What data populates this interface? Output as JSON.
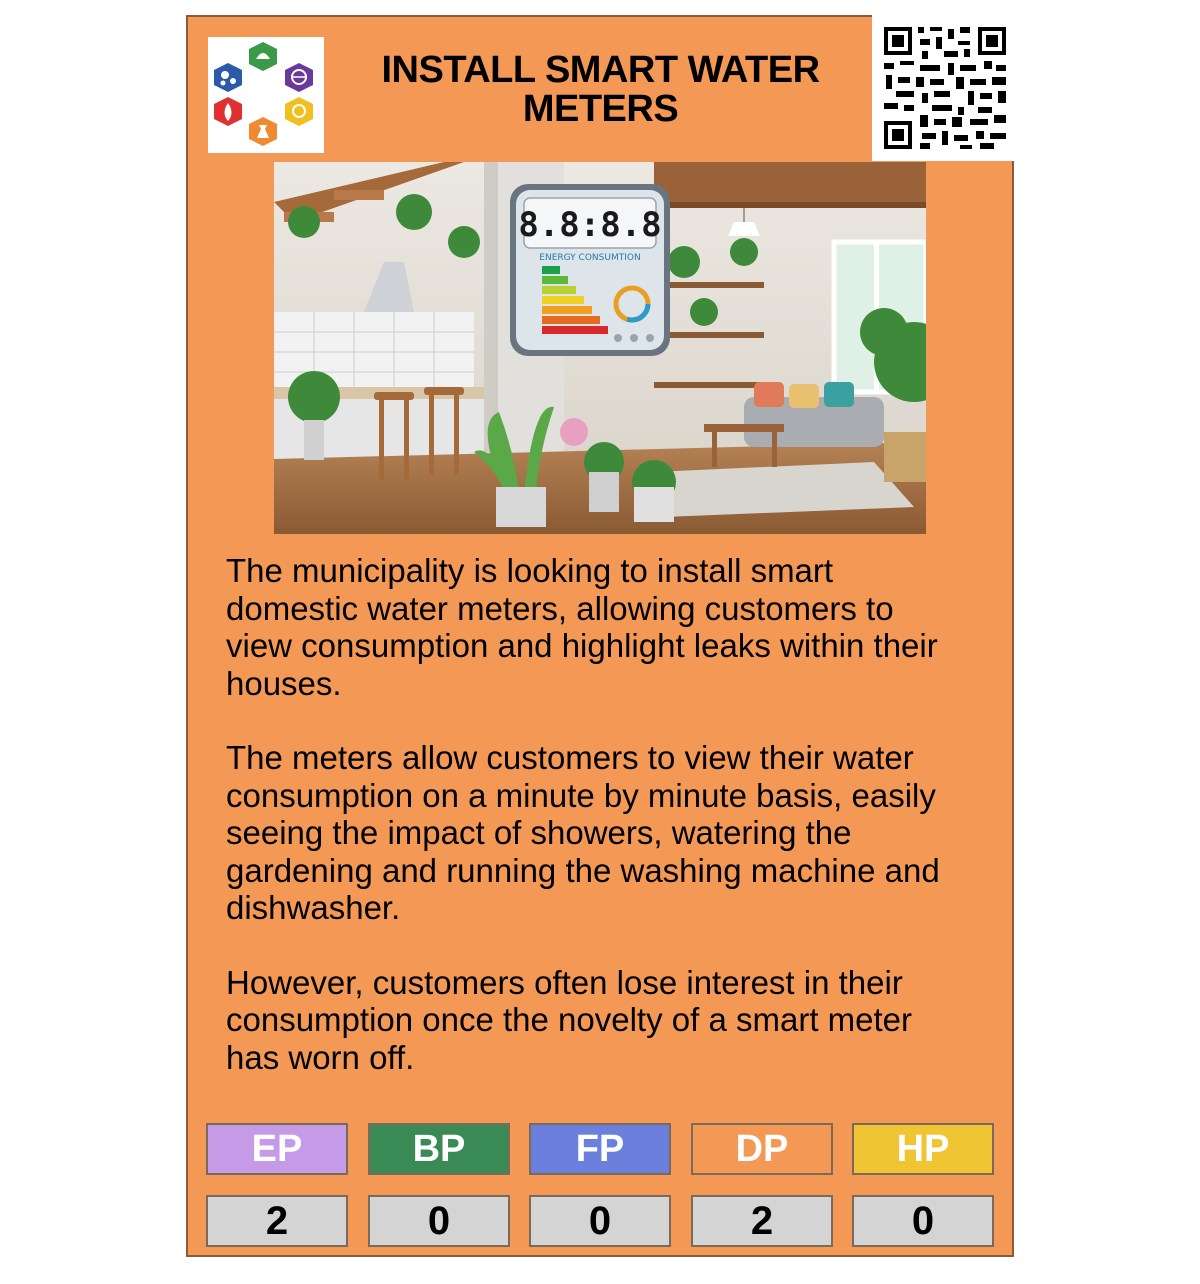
{
  "card": {
    "title": "INSTALL SMART WATER METERS",
    "colors": {
      "background": "#f49856"
    }
  },
  "logo": {
    "icon": "hexagon-sector-icons-logo"
  },
  "qr_code": {
    "icon": "qr-code-icon"
  },
  "hero_image": {
    "meter_display": "8.8:8.8",
    "meter_caption": "ENERGY CONSUMTION"
  },
  "description": {
    "paragraphs": [
      "The municipality is looking to install smart domestic water meters, allowing customers to view consumption and highlight leaks within their houses.",
      "The meters allow customers to view their water consumption on a minute by minute basis, easily seeing the impact of showers, watering the gardening and running the washing machine and dishwasher.",
      "However, customers often lose interest in their consumption once the novelty of a smart meter has worn off."
    ]
  },
  "stats": [
    {
      "label": "EP",
      "value": "2",
      "color": "#c59be8"
    },
    {
      "label": "BP",
      "value": "0",
      "color": "#3a8a55"
    },
    {
      "label": "FP",
      "value": "0",
      "color": "#6a80dc"
    },
    {
      "label": "DP",
      "value": "2",
      "color": "#f49856"
    },
    {
      "label": "HP",
      "value": "0",
      "color": "#f0c432"
    }
  ]
}
